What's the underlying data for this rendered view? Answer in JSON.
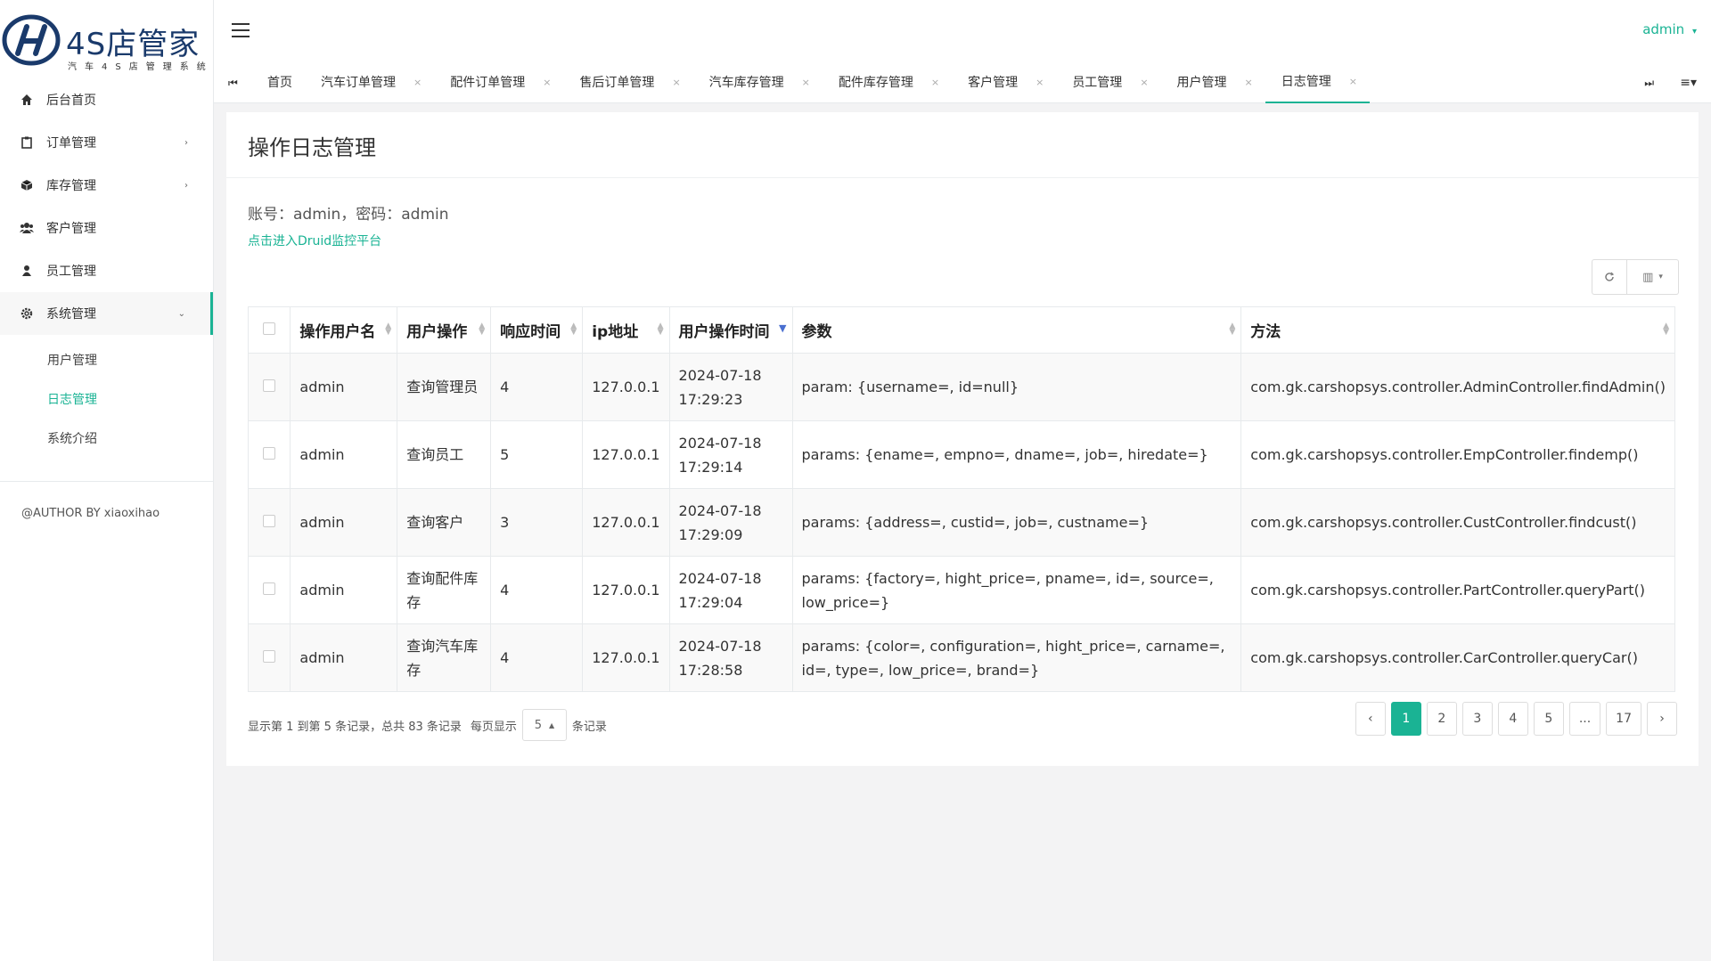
{
  "logo": {
    "title": "4S店管家",
    "subtitle": "汽车4S店管理系统"
  },
  "sidebar": {
    "items": [
      {
        "label": "后台首页",
        "icon": "home-icon"
      },
      {
        "label": "订单管理",
        "icon": "clipboard-icon"
      },
      {
        "label": "库存管理",
        "icon": "cube-icon"
      },
      {
        "label": "客户管理",
        "icon": "users-icon"
      },
      {
        "label": "员工管理",
        "icon": "user-icon"
      },
      {
        "label": "系统管理",
        "icon": "gear-icon"
      }
    ],
    "sub_items": [
      "用户管理",
      "日志管理",
      "系统介绍"
    ],
    "author": "@AUTHOR BY xiaoxihao"
  },
  "header": {
    "user": "admin"
  },
  "tabs": [
    {
      "label": "首页"
    },
    {
      "label": "汽车订单管理"
    },
    {
      "label": "配件订单管理"
    },
    {
      "label": "售后订单管理"
    },
    {
      "label": "汽车库存管理"
    },
    {
      "label": "配件库存管理"
    },
    {
      "label": "客户管理"
    },
    {
      "label": "员工管理"
    },
    {
      "label": "用户管理"
    },
    {
      "label": "日志管理"
    }
  ],
  "page": {
    "title": "操作日志管理",
    "account_info": "账号：admin，密码：admin",
    "druid_link": "点击进入Druid监控平台"
  },
  "table": {
    "columns": [
      "操作用户名",
      "用户操作",
      "响应时间",
      "ip地址",
      "用户操作时间",
      "参数",
      "方法"
    ],
    "rows": [
      {
        "user": "admin",
        "action": "查询管理员",
        "resp": "4",
        "ip": "127.0.0.1",
        "date": "2024-07-18",
        "time": "17:29:23",
        "params": "param: {username=, id=null}",
        "method": "com.gk.carshopsys.controller.AdminController.findAdmin()"
      },
      {
        "user": "admin",
        "action": "查询员工",
        "resp": "5",
        "ip": "127.0.0.1",
        "date": "2024-07-18",
        "time": "17:29:14",
        "params": "params: {ename=, empno=, dname=, job=, hiredate=}",
        "method": "com.gk.carshopsys.controller.EmpController.findemp()"
      },
      {
        "user": "admin",
        "action": "查询客户",
        "resp": "3",
        "ip": "127.0.0.1",
        "date": "2024-07-18",
        "time": "17:29:09",
        "params": "params: {address=, custid=, job=, custname=}",
        "method": "com.gk.carshopsys.controller.CustController.findcust()"
      },
      {
        "user": "admin",
        "action": "查询配件库存",
        "resp": "4",
        "ip": "127.0.0.1",
        "date": "2024-07-18",
        "time": "17:29:04",
        "params": "params: {factory=, hight_price=, pname=, id=, source=, low_price=}",
        "method": "com.gk.carshopsys.controller.PartController.queryPart()"
      },
      {
        "user": "admin",
        "action": "查询汽车库存",
        "resp": "4",
        "ip": "127.0.0.1",
        "date": "2024-07-18",
        "time": "17:28:58",
        "params": "params: {color=, configuration=, hight_price=, carname=, id=, type=, low_price=, brand=}",
        "method": "com.gk.carshopsys.controller.CarController.queryCar()"
      }
    ]
  },
  "footer": {
    "summary": "显示第 1 到第 5 条记录，总共 83 条记录",
    "per_page_prefix": "每页显示",
    "per_page_value": "5",
    "per_page_suffix": "条记录"
  },
  "pagination": {
    "prev": "‹",
    "pages": [
      "1",
      "2",
      "3",
      "4",
      "5",
      "...",
      "17"
    ],
    "next": "›"
  },
  "colors": {
    "accent": "#1ab394",
    "brand": "#1a3a6b"
  }
}
